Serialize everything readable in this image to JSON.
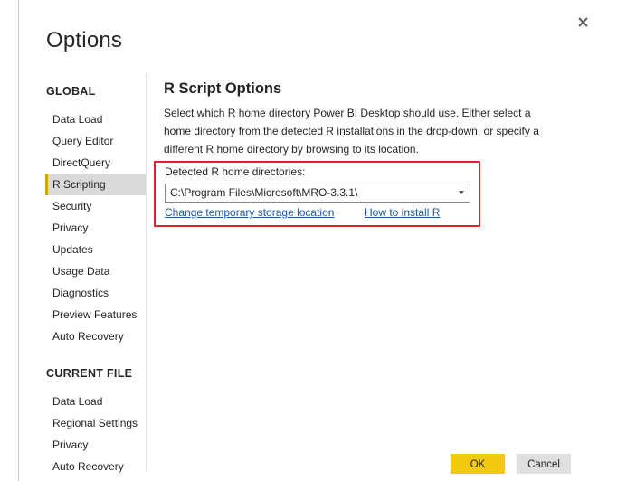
{
  "dialog": {
    "title": "Options",
    "close_icon": "close-icon"
  },
  "nav": {
    "global_heading": "GLOBAL",
    "global_items": [
      {
        "label": "Data Load"
      },
      {
        "label": "Query Editor"
      },
      {
        "label": "DirectQuery"
      },
      {
        "label": "R Scripting",
        "active": true
      },
      {
        "label": "Security"
      },
      {
        "label": "Privacy"
      },
      {
        "label": "Updates"
      },
      {
        "label": "Usage Data"
      },
      {
        "label": "Diagnostics"
      },
      {
        "label": "Preview Features"
      },
      {
        "label": "Auto Recovery"
      }
    ],
    "current_heading": "CURRENT FILE",
    "current_items": [
      {
        "label": "Data Load"
      },
      {
        "label": "Regional Settings"
      },
      {
        "label": "Privacy"
      },
      {
        "label": "Auto Recovery"
      }
    ]
  },
  "content": {
    "section_title": "R Script Options",
    "description_lines": [
      "Select which R home directory Power BI Desktop should use. Either select a",
      "home directory from the detected R installations in the drop-down, or specify a",
      "different R home directory by browsing to its location."
    ],
    "detected_label": "Detected R home directories:",
    "detected_value": "C:\\Program Files\\Microsoft\\MRO-3.3.1\\",
    "link_storage": "Change temporary storage location",
    "link_install": "How to install R"
  },
  "footer": {
    "ok_label": "OK",
    "cancel_label": "Cancel"
  },
  "colors": {
    "accent": "#f2c811",
    "highlight_border": "#e0202a",
    "link": "#1a5aa6",
    "active_nav_bg": "#dad9d8"
  }
}
